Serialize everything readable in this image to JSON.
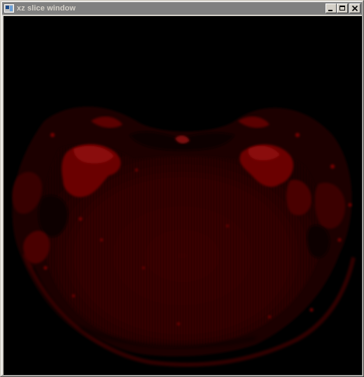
{
  "window": {
    "title": "xz slice window"
  },
  "titlebar_buttons": {
    "minimize_icon": "minimize-icon",
    "maximize_icon": "maximize-icon",
    "close_icon": "close-icon"
  },
  "image": {
    "colors": {
      "background": "#000000",
      "tissue_dark": "#2a0000",
      "tissue_mid": "#4a0000",
      "tissue_bright": "#7a0000",
      "tissue_highlight": "#a01010"
    }
  }
}
